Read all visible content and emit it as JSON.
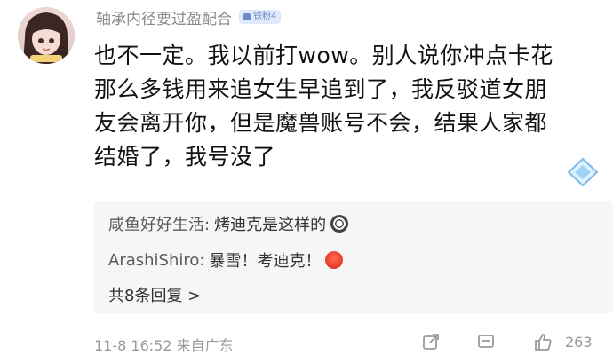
{
  "comment": {
    "username": "轴承内径要过盈配合",
    "badge": "铁粉4",
    "lines": [
      "也不一定。我以前打wow。别人说你冲点卡花",
      "那么多钱用来追女生早追到了，我反驳道女朋",
      "友会离开你，但是魔兽账号不会，结果人家都",
      "结婚了，我号没了"
    ]
  },
  "replies": {
    "items": [
      {
        "name": "咸鱼好好生活:",
        "text": "烤迪克是这样的",
        "emoji": "gear-emoji"
      },
      {
        "name": "ArashiShiro:",
        "text": "暴雪！考迪克！",
        "emoji": "angry-face-emoji"
      }
    ],
    "more_label": "共8条回复 >"
  },
  "footer": {
    "time": "11-8 16:52 来自广东",
    "likes": "263"
  },
  "colors": {
    "badge_bg": "#dfe9fb",
    "badge_text": "#6f89c8",
    "meta_text": "#9a9a9a"
  }
}
